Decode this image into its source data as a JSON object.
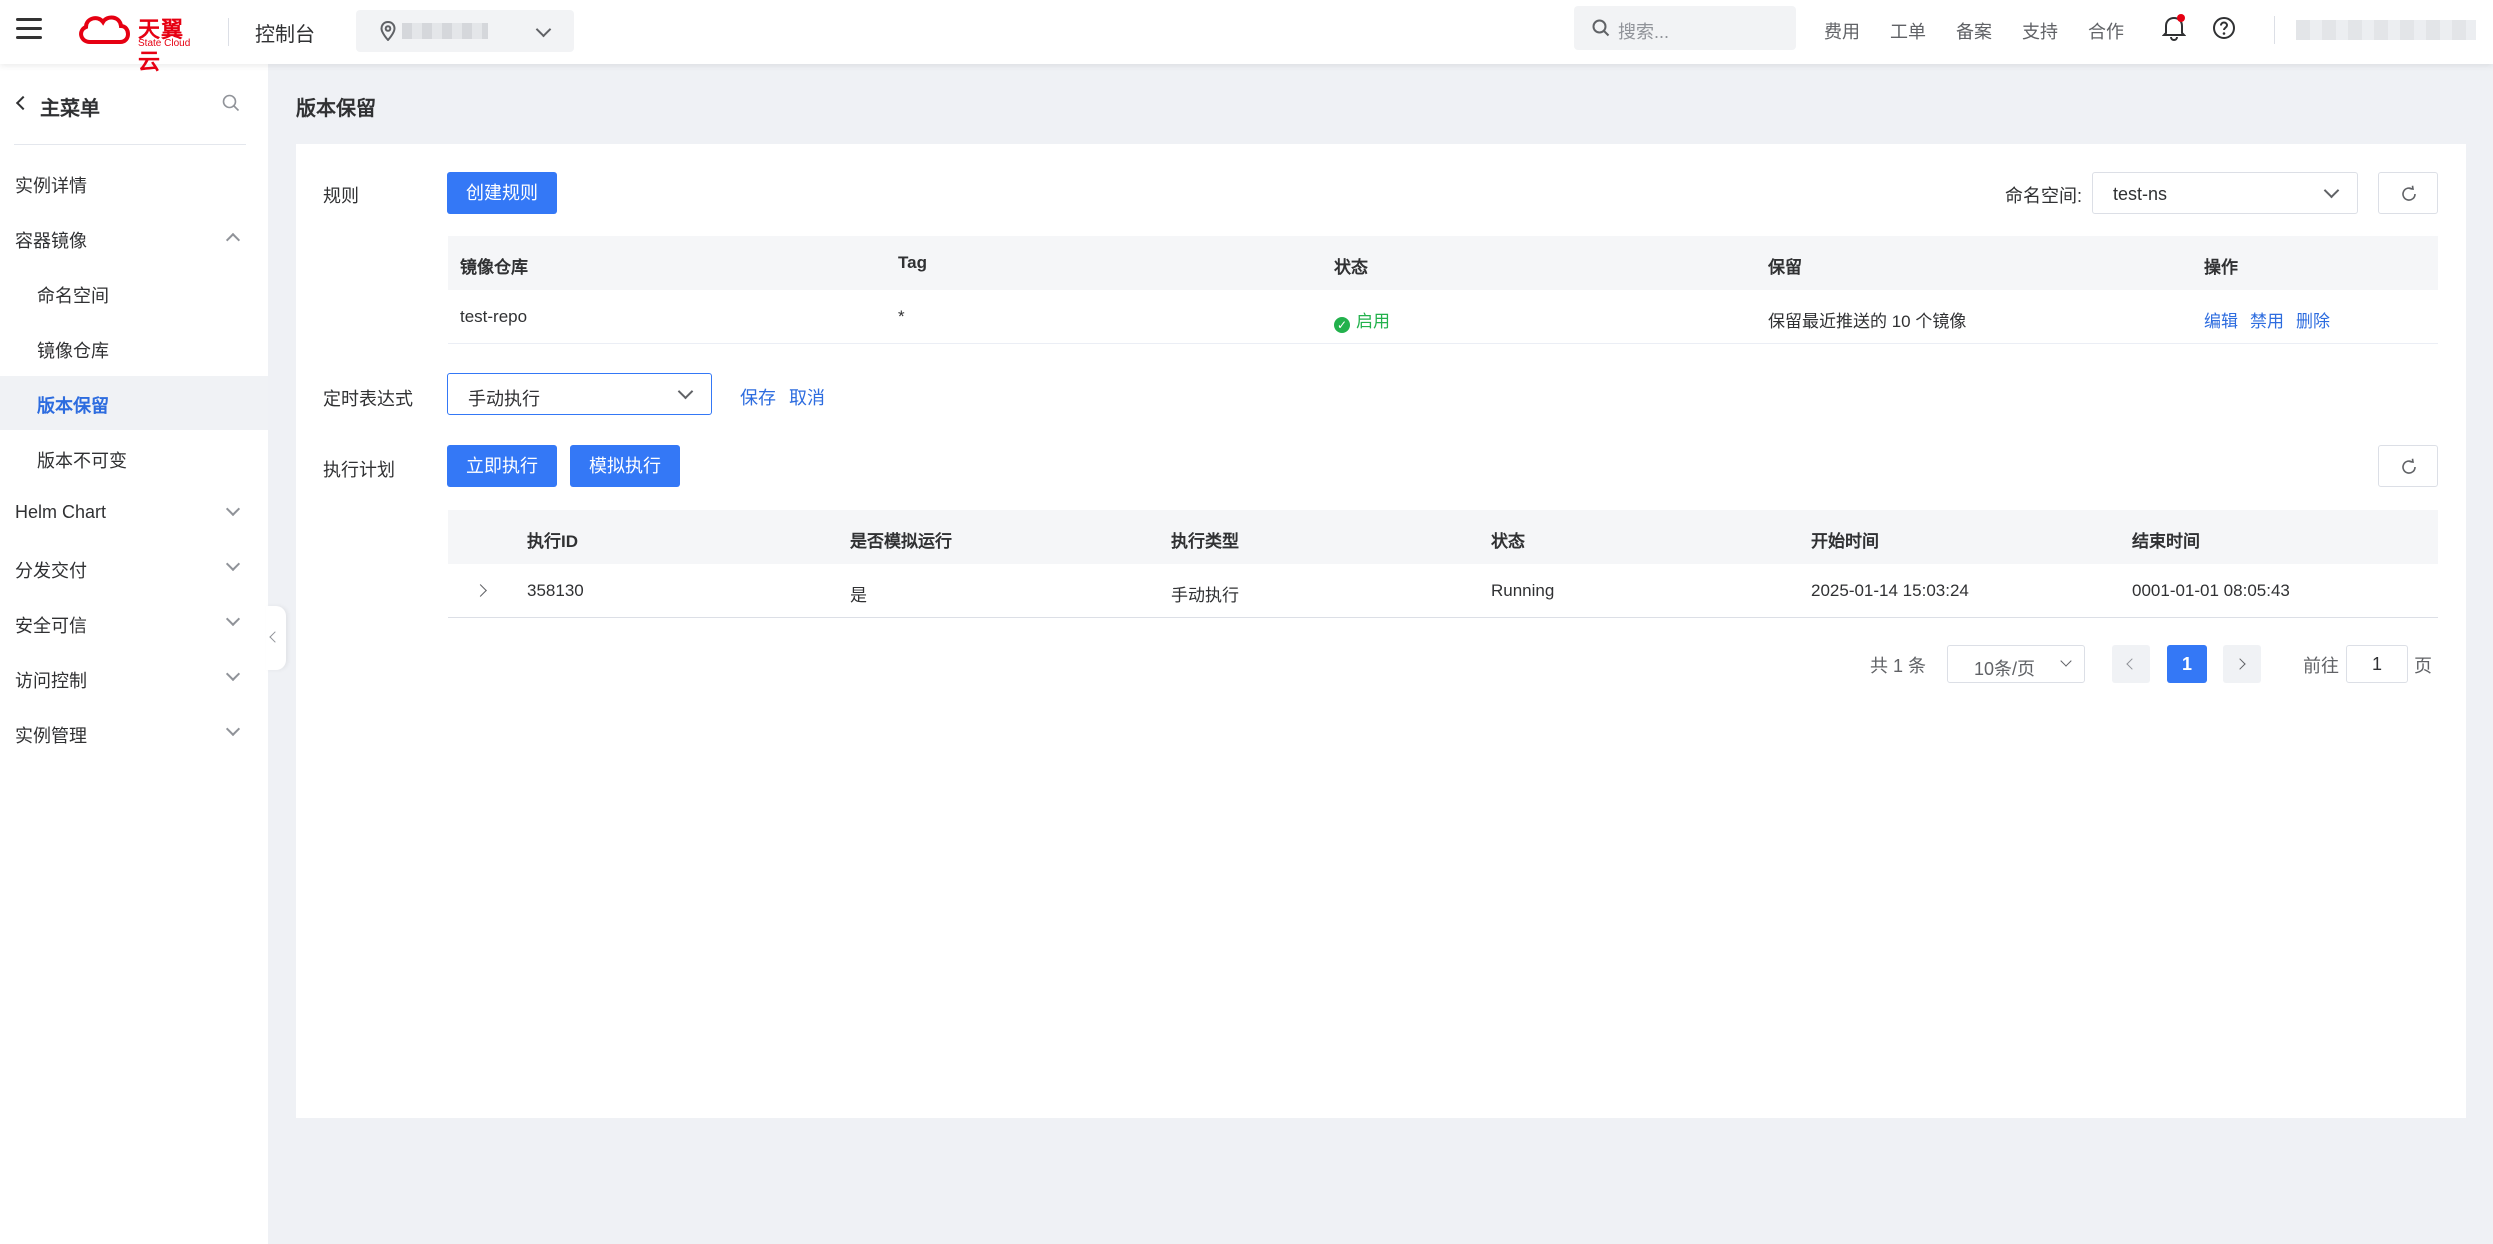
{
  "topbar": {
    "logo_cn": "天翼云",
    "logo_en": "State Cloud",
    "console": "控制台",
    "search_placeholder": "搜索...",
    "nav": [
      "费用",
      "工单",
      "备案",
      "支持",
      "合作"
    ]
  },
  "sidebar": {
    "header": "主菜单",
    "items": [
      {
        "label": "实例详情"
      },
      {
        "label": "容器镜像"
      },
      {
        "label": "命名空间"
      },
      {
        "label": "镜像仓库"
      },
      {
        "label": "版本保留"
      },
      {
        "label": "版本不可变"
      },
      {
        "label": "Helm Chart"
      },
      {
        "label": "分发交付"
      },
      {
        "label": "安全可信"
      },
      {
        "label": "访问控制"
      },
      {
        "label": "实例管理"
      }
    ]
  },
  "page": {
    "title": "版本保留",
    "rules_label": "规则",
    "create_rule": "创建规则",
    "namespace_label": "命名空间:",
    "namespace_value": "test-ns",
    "rules_table": {
      "headers": [
        "镜像仓库",
        "Tag",
        "状态",
        "保留",
        "操作"
      ],
      "rows": [
        {
          "repo": "test-repo",
          "tag": "*",
          "status": "启用",
          "retain": "保留最近推送的 10 个镜像",
          "actions": [
            "编辑",
            "禁用",
            "删除"
          ]
        }
      ]
    },
    "cron_label": "定时表达式",
    "cron_value": "手动执行",
    "save": "保存",
    "cancel": "取消",
    "plan_label": "执行计划",
    "run_now": "立即执行",
    "simulate": "模拟执行",
    "exec_table": {
      "headers": [
        "执行ID",
        "是否模拟运行",
        "执行类型",
        "状态",
        "开始时间",
        "结束时间"
      ],
      "rows": [
        {
          "id": "358130",
          "simulated": "是",
          "type": "手动执行",
          "status": "Running",
          "start": "2025-01-14 15:03:24",
          "end": "0001-01-01 08:05:43"
        }
      ]
    },
    "pager": {
      "total": "共 1 条",
      "page_size": "10条/页",
      "current": "1",
      "goto_label": "前往",
      "goto_value": "1",
      "page_suffix": "页"
    }
  }
}
